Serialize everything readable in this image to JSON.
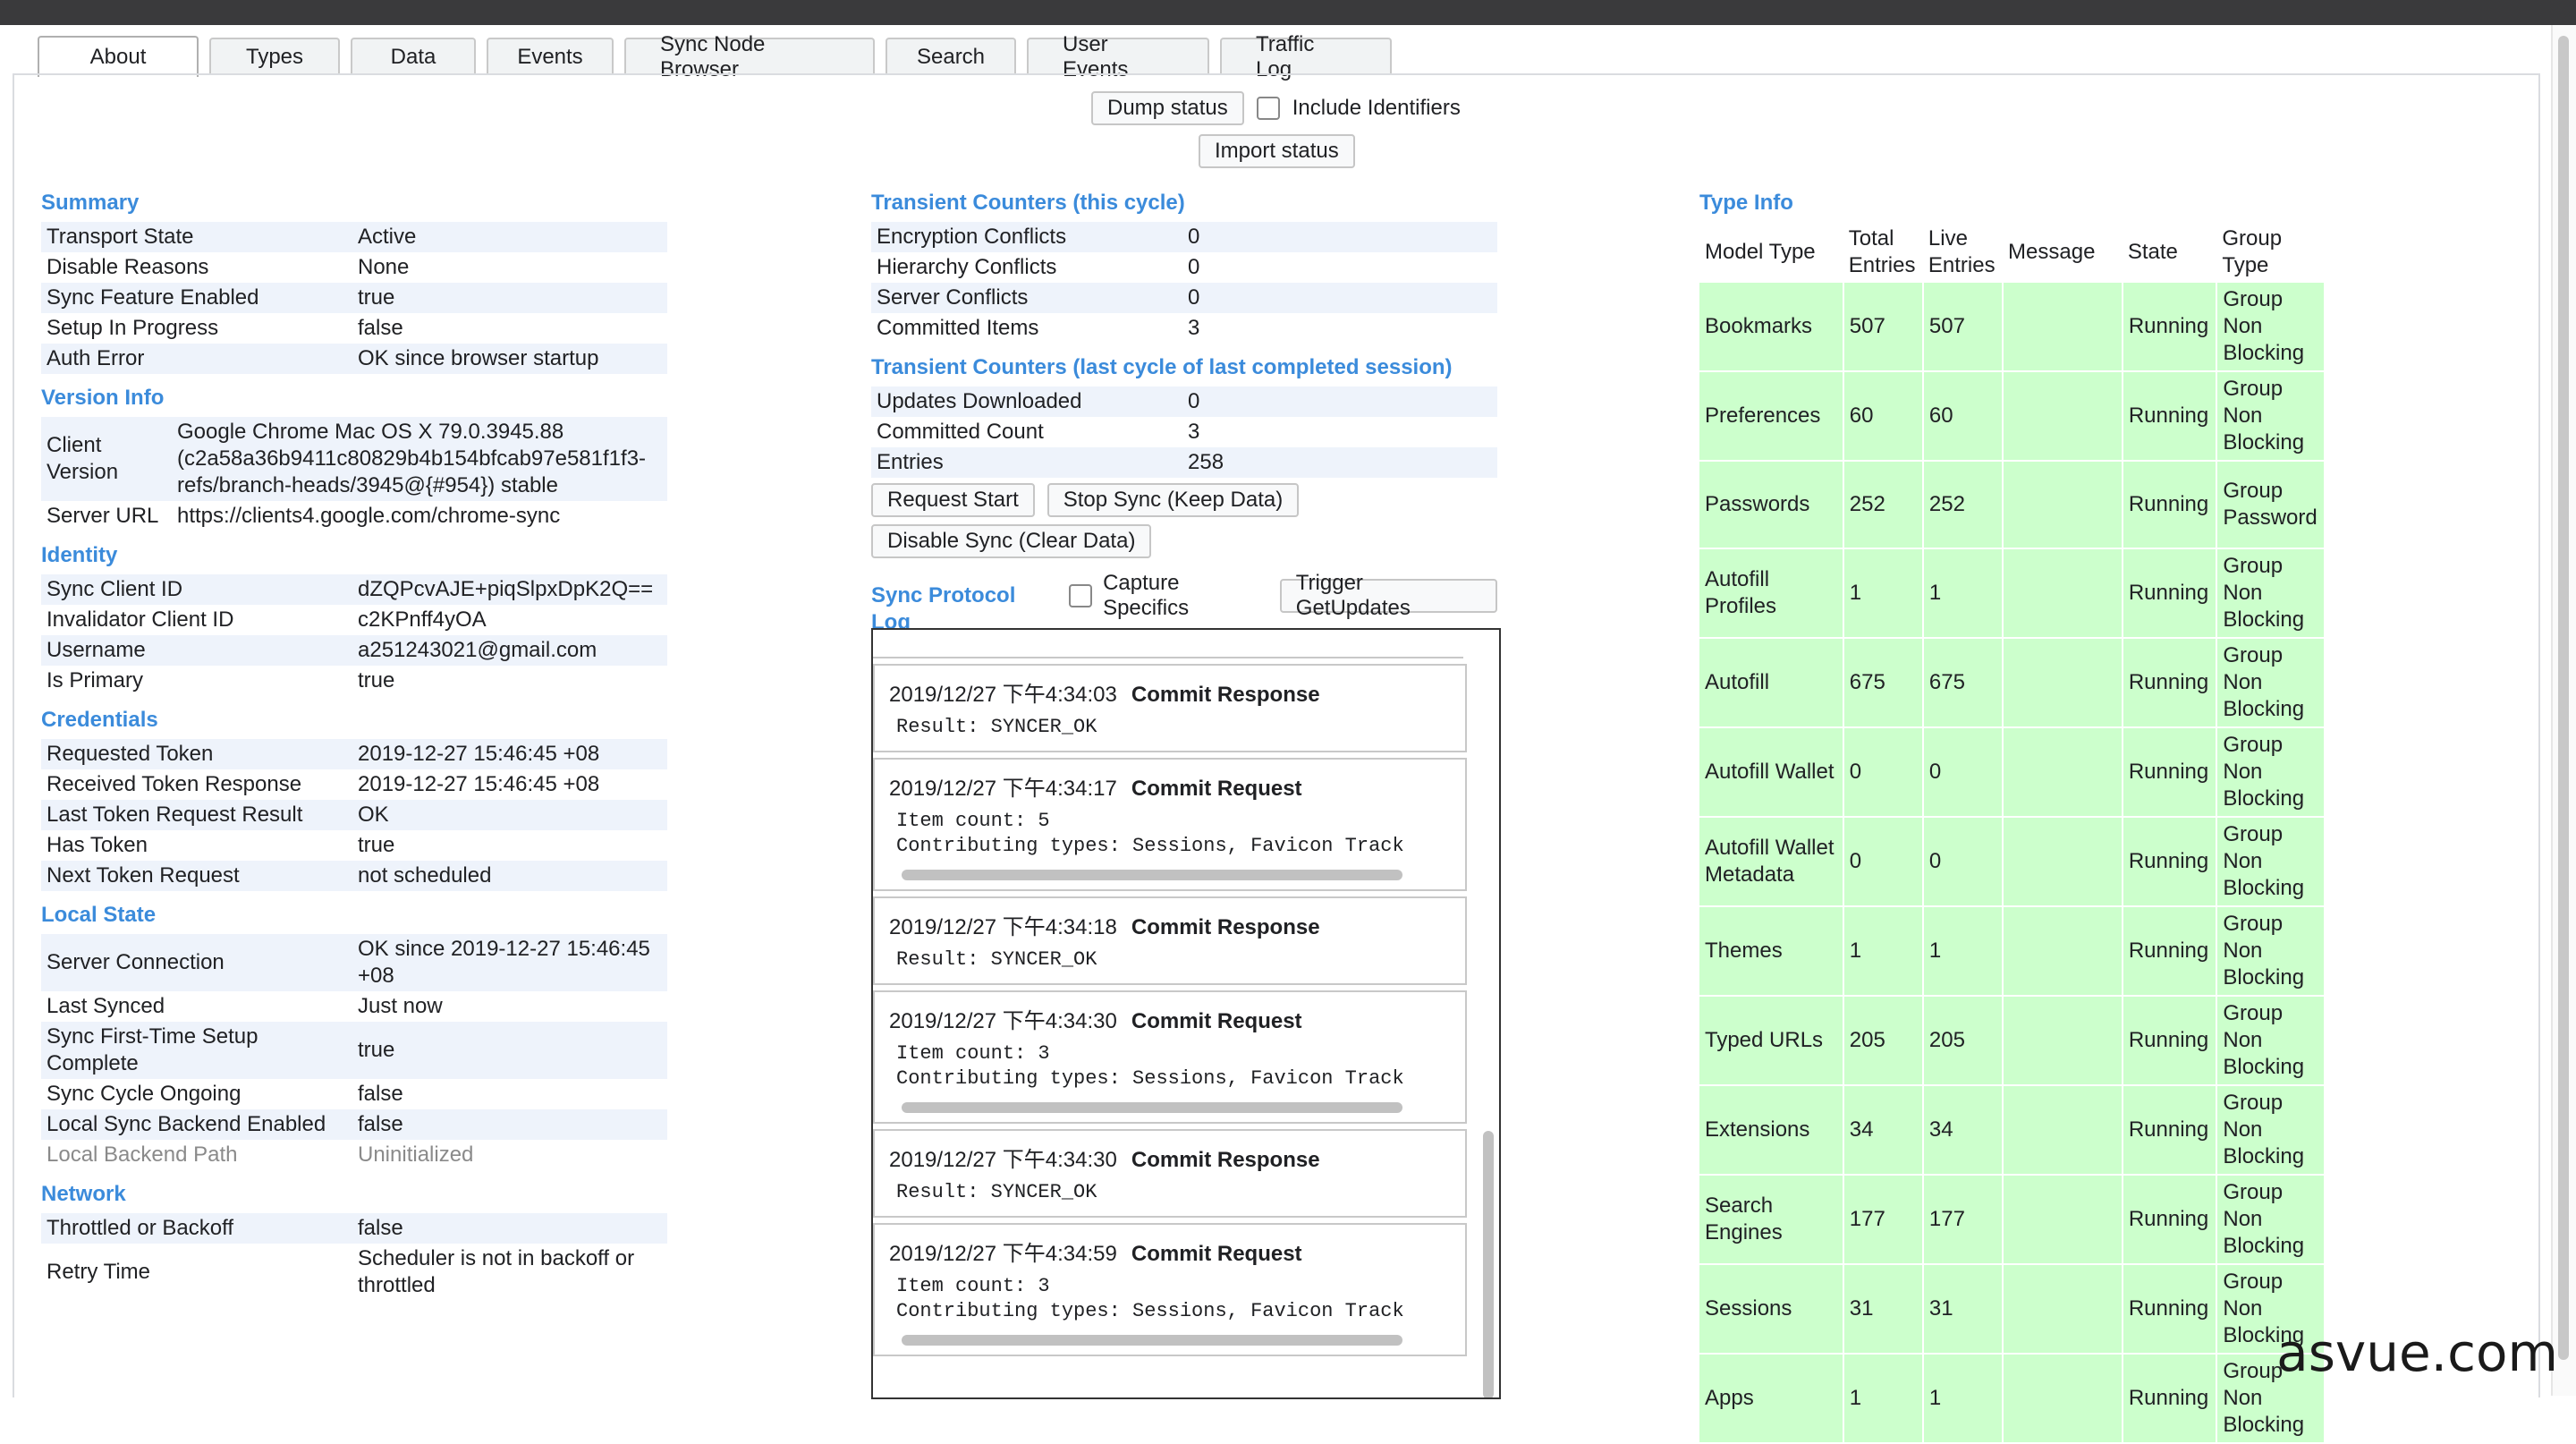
{
  "tabs": [
    "About",
    "Types",
    "Data",
    "Events",
    "Sync Node Browser",
    "Search",
    "User Events",
    "Traffic Log"
  ],
  "controls": {
    "dump_status": "Dump status",
    "include_identifiers": "Include Identifiers",
    "import_status": "Import status"
  },
  "summary": {
    "title": "Summary",
    "rows": [
      [
        "Transport State",
        "Active"
      ],
      [
        "Disable Reasons",
        "None"
      ],
      [
        "Sync Feature Enabled",
        "true"
      ],
      [
        "Setup In Progress",
        "false"
      ],
      [
        "Auth Error",
        "OK since browser startup"
      ]
    ]
  },
  "version_info": {
    "title": "Version Info",
    "rows": [
      [
        "Client Version",
        "Google Chrome Mac OS X 79.0.3945.88 (c2a58a36b9411c80829b4b154bfcab97e581f1f3-refs/branch-heads/3945@{#954}) stable"
      ],
      [
        "Server URL",
        "https://clients4.google.com/chrome-sync"
      ]
    ]
  },
  "identity": {
    "title": "Identity",
    "rows": [
      [
        "Sync Client ID",
        "dZQPcvAJE+piqSlpxDpK2Q=="
      ],
      [
        "Invalidator Client ID",
        "c2KPnff4yOA"
      ],
      [
        "Username",
        "a251243021@gmail.com"
      ],
      [
        "Is Primary",
        "true"
      ]
    ]
  },
  "credentials": {
    "title": "Credentials",
    "rows": [
      [
        "Requested Token",
        "2019-12-27 15:46:45 +08"
      ],
      [
        "Received Token Response",
        "2019-12-27 15:46:45 +08"
      ],
      [
        "Last Token Request Result",
        "OK"
      ],
      [
        "Has Token",
        "true"
      ],
      [
        "Next Token Request",
        "not scheduled"
      ]
    ]
  },
  "local_state": {
    "title": "Local State",
    "rows": [
      [
        "Server Connection",
        "OK since 2019-12-27 15:46:45 +08"
      ],
      [
        "Last Synced",
        "Just now"
      ],
      [
        "Sync First-Time Setup Complete",
        "true"
      ],
      [
        "Sync Cycle Ongoing",
        "false"
      ],
      [
        "Local Sync Backend Enabled",
        "false"
      ],
      [
        "Local Backend Path",
        "Uninitialized"
      ]
    ]
  },
  "network": {
    "title": "Network",
    "rows": [
      [
        "Throttled or Backoff",
        "false"
      ],
      [
        "Retry Time",
        "Scheduler is not in backoff or throttled"
      ]
    ]
  },
  "transient_cycle": {
    "title": "Transient Counters (this cycle)",
    "rows": [
      [
        "Encryption Conflicts",
        "0"
      ],
      [
        "Hierarchy Conflicts",
        "0"
      ],
      [
        "Server Conflicts",
        "0"
      ],
      [
        "Committed Items",
        "3"
      ]
    ]
  },
  "transient_last": {
    "title": "Transient Counters (last cycle of last completed session)",
    "rows": [
      [
        "Updates Downloaded",
        "0"
      ],
      [
        "Committed Count",
        "3"
      ],
      [
        "Entries",
        "258"
      ]
    ]
  },
  "actions": {
    "request_start": "Request Start",
    "stop_sync": "Stop Sync (Keep Data)",
    "disable_sync": "Disable Sync (Clear Data)"
  },
  "protocol_log": {
    "title": "Sync Protocol Log",
    "capture_specifics": "Capture Specifics",
    "trigger": "Trigger GetUpdates",
    "entries": [
      {
        "time": "2019/12/27 下午4:34:03",
        "type": "Commit Response",
        "body": "Result: SYNCER_OK",
        "scroll": false
      },
      {
        "time": "2019/12/27 下午4:34:17",
        "type": "Commit Request",
        "body": "Item count: 5\nContributing types: Sessions, Favicon Track",
        "scroll": true
      },
      {
        "time": "2019/12/27 下午4:34:18",
        "type": "Commit Response",
        "body": "Result: SYNCER_OK",
        "scroll": false
      },
      {
        "time": "2019/12/27 下午4:34:30",
        "type": "Commit Request",
        "body": "Item count: 3\nContributing types: Sessions, Favicon Track",
        "scroll": true
      },
      {
        "time": "2019/12/27 下午4:34:30",
        "type": "Commit Response",
        "body": "Result: SYNCER_OK",
        "scroll": false
      },
      {
        "time": "2019/12/27 下午4:34:59",
        "type": "Commit Request",
        "body": "Item count: 3\nContributing types: Sessions, Favicon Track",
        "scroll": true
      }
    ]
  },
  "type_info": {
    "title": "Type Info",
    "headers": [
      "Model Type",
      "Total Entries",
      "Live Entries",
      "Message",
      "State",
      "Group Type"
    ],
    "rows": [
      [
        "Bookmarks",
        "507",
        "507",
        "",
        "Running",
        "Group Non Blocking"
      ],
      [
        "Preferences",
        "60",
        "60",
        "",
        "Running",
        "Group Non Blocking"
      ],
      [
        "Passwords",
        "252",
        "252",
        "",
        "Running",
        "Group Password"
      ],
      [
        "Autofill Profiles",
        "1",
        "1",
        "",
        "Running",
        "Group Non Blocking"
      ],
      [
        "Autofill",
        "675",
        "675",
        "",
        "Running",
        "Group Non Blocking"
      ],
      [
        "Autofill Wallet",
        "0",
        "0",
        "",
        "Running",
        "Group Non Blocking"
      ],
      [
        "Autofill Wallet Metadata",
        "0",
        "0",
        "",
        "Running",
        "Group Non Blocking"
      ],
      [
        "Themes",
        "1",
        "1",
        "",
        "Running",
        "Group Non Blocking"
      ],
      [
        "Typed URLs",
        "205",
        "205",
        "",
        "Running",
        "Group Non Blocking"
      ],
      [
        "Extensions",
        "34",
        "34",
        "",
        "Running",
        "Group Non Blocking"
      ],
      [
        "Search Engines",
        "177",
        "177",
        "",
        "Running",
        "Group Non Blocking"
      ],
      [
        "Sessions",
        "31",
        "31",
        "",
        "Running",
        "Group Non Blocking"
      ],
      [
        "Apps",
        "1",
        "1",
        "",
        "Running",
        "Group Non Blocking"
      ]
    ]
  },
  "watermark": "asvue.com"
}
